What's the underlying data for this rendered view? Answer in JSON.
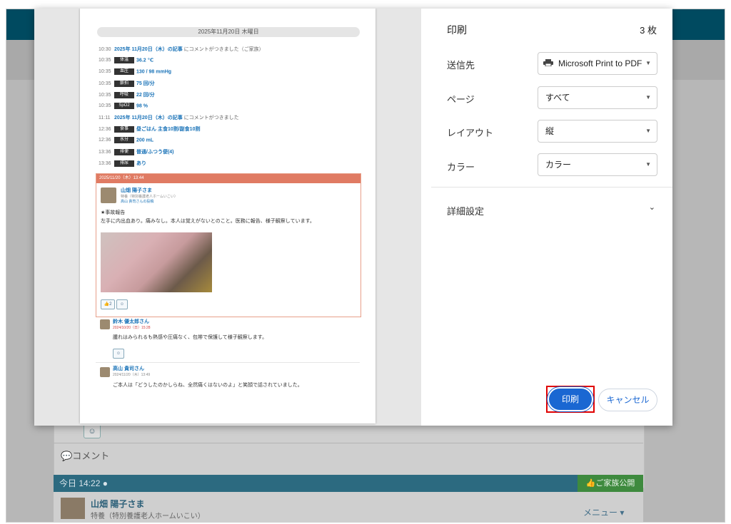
{
  "background_app": {
    "comment_label": "コメント",
    "timeline_time": "今日 14:22",
    "public_button": "ご家族公開",
    "post_name": "山畑 陽子さま",
    "post_facility": "特養（特別養護老人ホームいこい）",
    "menu_label": "メニュー ▾",
    "reaction_icon": "smile-icon"
  },
  "preview": {
    "date_header": "2025年11月20日 木曜日",
    "log": [
      {
        "time": "10:30",
        "link": "2025年 11月20日（木）の記事",
        "text": " にコメントがつきました（ご家族）"
      },
      {
        "time": "10:35",
        "tag": "体温",
        "value": "36.2 ℃"
      },
      {
        "time": "10:35",
        "tag": "血圧",
        "value": "130 / 98 mmHg"
      },
      {
        "time": "10:35",
        "tag": "脈拍",
        "value": "75 回/分"
      },
      {
        "time": "10:35",
        "tag": "呼吸",
        "value": "22 回/分"
      },
      {
        "time": "10:35",
        "tag": "SpO2",
        "value": "98 %"
      },
      {
        "time": "11:11",
        "link": "2025年 11月20日（木）の記事",
        "text": " にコメントがつきました"
      },
      {
        "time": "12:36",
        "tag": "食事",
        "value": "昼ごはん 主食10割/副食10割"
      },
      {
        "time": "12:36",
        "tag": "水分",
        "value": "200 mL"
      },
      {
        "time": "13:36",
        "tag": "排便",
        "value": "普通/ふつう便(4)"
      },
      {
        "time": "13:36",
        "tag": "排尿",
        "value": "あり"
      }
    ],
    "post": {
      "header": "2025/11/20（木）13:44",
      "name": "山畑 陽子さま",
      "facility": "特養（特別養護老人ホームいこい）",
      "author": "高山 貴司さんの投稿",
      "title": "★事故報告",
      "body": "左手に内出血あり。痛みなし。本人は覚えがないとのこと。医務に報告、様子観察しています。",
      "reaction_count": "2"
    },
    "comments": [
      {
        "name": "鈴木 優太郎さん",
        "date": "2024/10/20（日）15:28",
        "text": "腫れはみられるも熱感や圧痛なく、包帯で保護して様子観察します。"
      },
      {
        "name": "高山 貴司さん",
        "date": "2024/11/20（木）13:49",
        "text": "ご本人は「どうしたのかしらね、全然痛くはないのよ」と笑顔で話されていました。"
      }
    ]
  },
  "settings": {
    "title": "印刷",
    "sheet_count": "3 枚",
    "rows": [
      {
        "label": "送信先",
        "value": "Microsoft Print to PDF"
      },
      {
        "label": "ページ",
        "value": "すべて"
      },
      {
        "label": "レイアウト",
        "value": "縦"
      },
      {
        "label": "カラー",
        "value": "カラー"
      }
    ],
    "advanced_label": "詳細設定",
    "print_button": "印刷",
    "cancel_button": "キャンセル"
  }
}
